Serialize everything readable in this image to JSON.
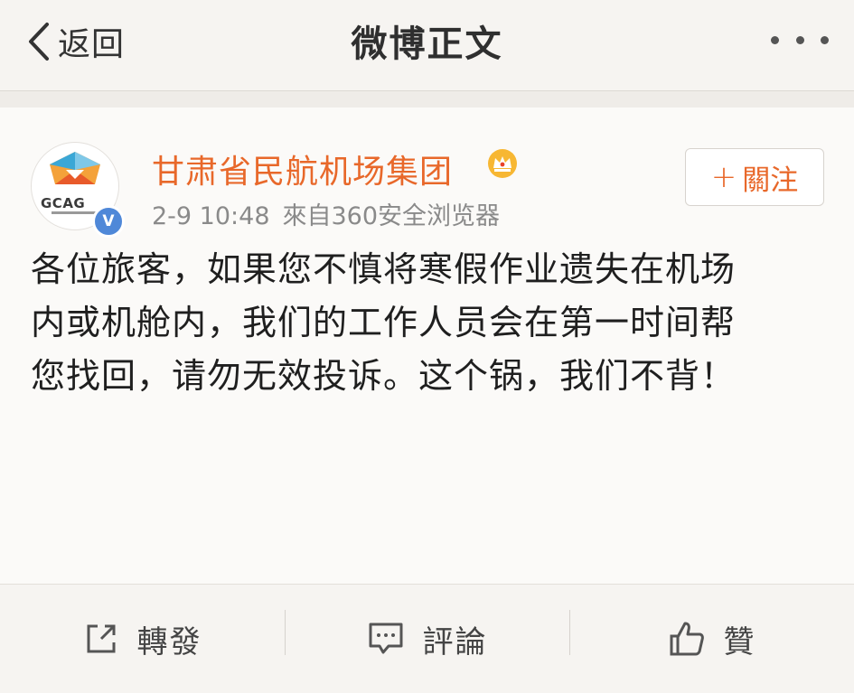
{
  "navbar": {
    "back_label": "返回",
    "title": "微博正文",
    "more_icon": "more-dots-icon"
  },
  "post": {
    "author": {
      "name": "甘肃省民航机场集团",
      "avatar_text": "GCAG",
      "verified_mark": "V",
      "badge_icon": "crown-icon"
    },
    "time": "2-9 10:48",
    "source": "來自360安全浏览器",
    "follow_button": {
      "plus": "+",
      "label": "關注"
    },
    "text_lines": [
      "各位旅客，如果您不慎将寒假作业遗失在机场",
      "内或机舱内，我们的工作人员会在第一时间帮",
      "您找回，请勿无效投诉。这个锅，我们不背！"
    ]
  },
  "actions": {
    "repost": {
      "label": "轉發",
      "icon": "share-icon"
    },
    "comment": {
      "label": "評論",
      "icon": "comment-icon"
    },
    "like": {
      "label": "贊",
      "icon": "thumbs-up-icon"
    }
  },
  "colors": {
    "accent": "#e8682a",
    "verified": "#4f88d8",
    "background": "#f6f4f1"
  }
}
